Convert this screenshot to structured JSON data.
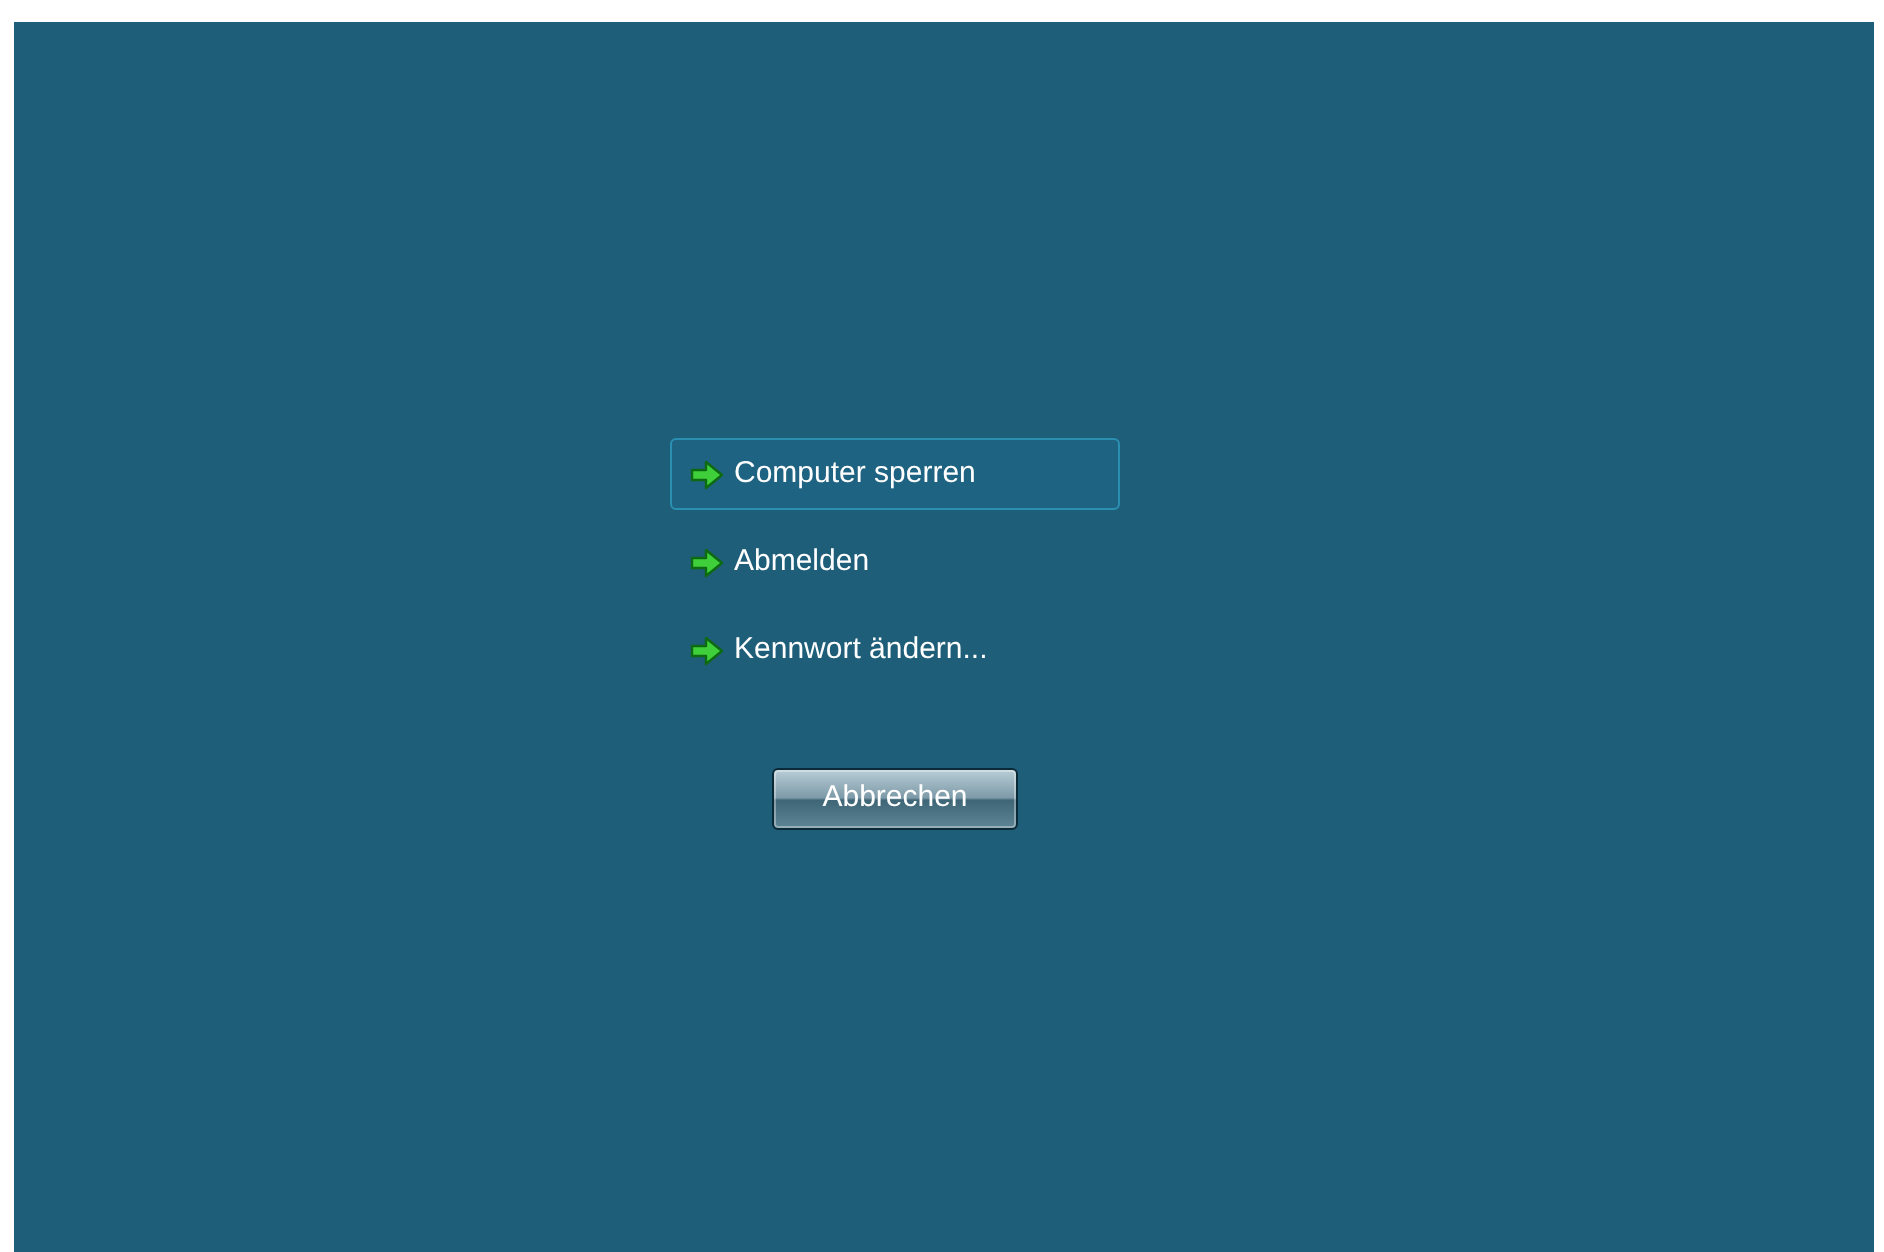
{
  "options": [
    {
      "label": "Computer sperren",
      "selected": true
    },
    {
      "label": "Abmelden",
      "selected": false
    },
    {
      "label": "Kennwort ändern...",
      "selected": false
    }
  ],
  "cancel_button": {
    "label": "Abbrechen"
  }
}
